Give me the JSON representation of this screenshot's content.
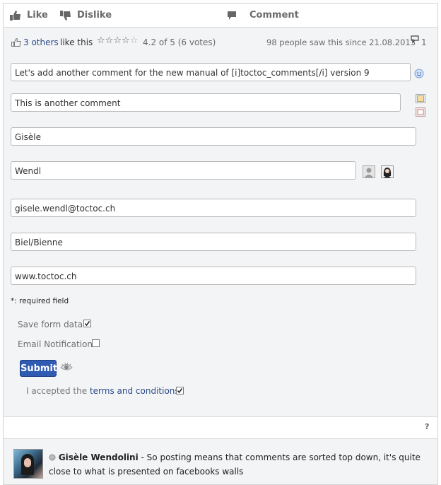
{
  "toolbar": {
    "like": "Like",
    "dislike": "Dislike",
    "comment": "Comment"
  },
  "stats": {
    "others_link": "3 others",
    "like_this": "like this",
    "rating_text": "4.2 of 5 (6 votes)",
    "rating_value": 4.2,
    "rating_max": 5,
    "views_text": "98 people saw this since 21.08.2013",
    "comment_count": "1"
  },
  "form": {
    "comment1": "Let's add another comment for the new manual of [i]toctoc_comments[/i] version 9",
    "comment2": "This is another comment",
    "firstname": "Gisèle",
    "lastname": "Wendl",
    "email": "gisele.wendl@toctoc.ch",
    "city": "Biel/Bienne",
    "website": "www.toctoc.ch",
    "required_note": "*: required field",
    "save_form_data": "Save form data",
    "save_form_data_checked": true,
    "email_notification": "Email Notification",
    "email_notification_checked": false,
    "submit": "Submit",
    "accepted_prefix": "I accepted the",
    "terms_link": "terms and conditions",
    "terms_checked": true
  },
  "help": "?",
  "latest_comment": {
    "author": "Gisèle Wendolini",
    "text_line1": " - So posting means that comments are sorted top down, it's quite",
    "text_line2": "close to what is presented on facebooks walls"
  },
  "colors": {
    "accent": "#2f5bb3",
    "link": "#2a4a88",
    "background": "#f3f4f6"
  },
  "icons": [
    "thumbs-up-icon",
    "thumbs-down-icon",
    "speech-bubble-icon",
    "small-thumb-icon",
    "star-icon",
    "comment-count-icon",
    "smiley-icon",
    "image-icon",
    "attachment-icon",
    "male-avatar-icon",
    "female-avatar-icon",
    "eye-icon",
    "status-dot-icon"
  ]
}
